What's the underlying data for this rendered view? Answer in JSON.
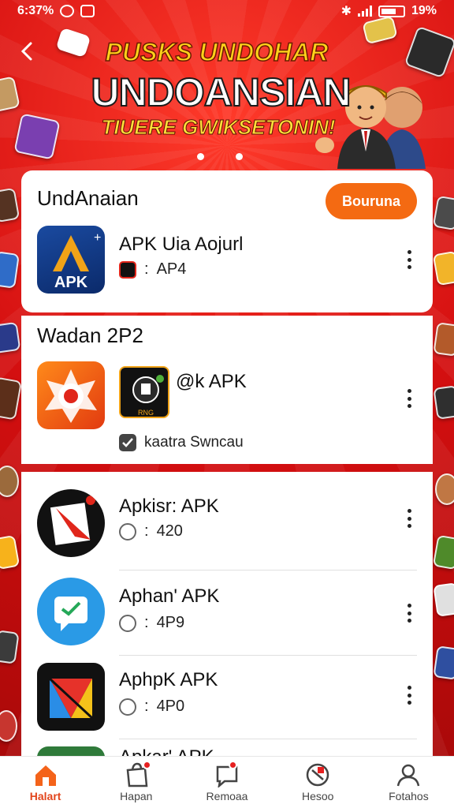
{
  "status_bar": {
    "time": "6:37%",
    "battery_text": "19%"
  },
  "banner": {
    "line1": "PUSKS UNDOHAR",
    "line2": "UNDOANSIAN",
    "line3": "TIUERE GWIKSETONIN!"
  },
  "section1": {
    "title": "UndAnaian",
    "button_label": "Bouruna",
    "app": {
      "name": "APK Uia Aojurl",
      "icon_text": "APK",
      "meta": "AP4"
    }
  },
  "section2": {
    "title": "Wadan 2P2",
    "app": {
      "name": "@k APK",
      "thumb_text": "RNG",
      "meta": "kaatra Swncau"
    }
  },
  "section3": {
    "apps": [
      {
        "name": "Apkisr: APK",
        "meta": "420"
      },
      {
        "name": "Aphan' APK",
        "meta": "4P9"
      },
      {
        "name": "AphpK APK",
        "meta": "4P0"
      },
      {
        "name": "Apkar' APK",
        "meta": ""
      }
    ]
  },
  "nav": [
    {
      "label": "Halart",
      "icon": "home-icon",
      "active": true
    },
    {
      "label": "Hapan",
      "icon": "bag-icon"
    },
    {
      "label": "Remoaa",
      "icon": "chat-icon"
    },
    {
      "label": "Hesoo",
      "icon": "shield-icon"
    },
    {
      "label": "Fotahos",
      "icon": "profile-icon"
    }
  ],
  "colors": {
    "accent": "#f46a12",
    "bg_red": "#d10f0f",
    "nav_active": "#e2451c"
  }
}
